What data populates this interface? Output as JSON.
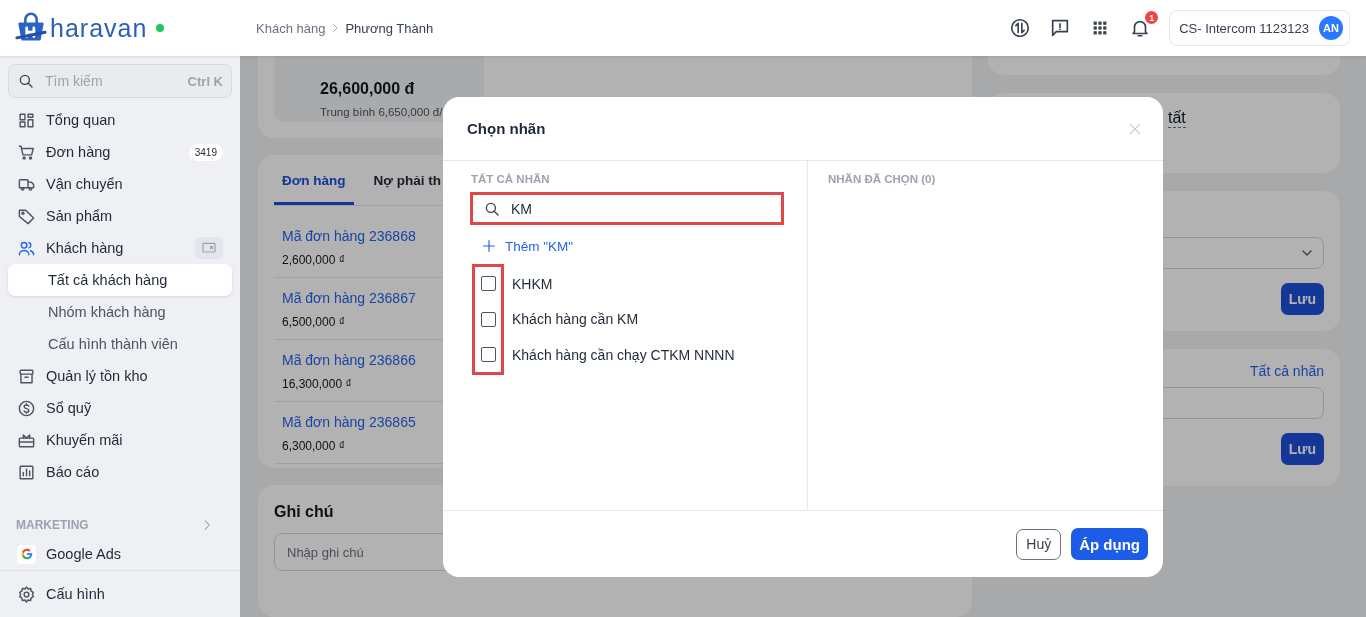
{
  "header": {
    "logo": "haravan",
    "breadcrumb": [
      "Khách hàng",
      "Phương Thành"
    ],
    "notification_count": "1",
    "account": {
      "name": "CS- Intercom 1123123",
      "initials": "AN"
    }
  },
  "sidebar": {
    "search": {
      "placeholder": "Tìm kiếm",
      "shortcut": "Ctrl K"
    },
    "items": [
      {
        "label": "Tổng quan",
        "active": false
      },
      {
        "label": "Đơn hàng",
        "active": false,
        "count": "3419"
      },
      {
        "label": "Vận chuyển",
        "active": false
      },
      {
        "label": "Sản phẩm",
        "active": false
      },
      {
        "label": "Khách hàng",
        "active": true,
        "children": [
          {
            "label": "Tất cả khách hàng",
            "selected": true
          },
          {
            "label": "Nhóm khách hàng",
            "selected": false
          },
          {
            "label": "Cấu hình thành viên",
            "selected": false
          }
        ]
      },
      {
        "label": "Quản lý tồn kho",
        "active": false
      },
      {
        "label": "Sổ quỹ",
        "active": false
      },
      {
        "label": "Khuyến mãi",
        "active": false
      },
      {
        "label": "Báo cáo",
        "active": false
      }
    ],
    "marketing": {
      "title": "MARKETING",
      "items": [
        {
          "label": "Google Ads"
        }
      ]
    },
    "footer_item": {
      "label": "Cấu hình"
    }
  },
  "summary": {
    "total": "26,600,000 đ",
    "average": "Trung bình 6,650,000 đ/"
  },
  "orders_card": {
    "tabs": [
      {
        "label": "Đơn hàng",
        "selected": true
      },
      {
        "label": "Nợ phải th",
        "selected": false
      }
    ],
    "orders": [
      {
        "code": "Mã đơn hàng 236868",
        "amount": "2,600,000 ₫"
      },
      {
        "code": "Mã đơn hàng 236867",
        "amount": "6,500,000 ₫"
      },
      {
        "code": "Mã đơn hàng 236866",
        "amount": "16,300,000 ₫"
      },
      {
        "code": "Mã đơn hàng 236865",
        "amount": "6,300,000 ₫"
      }
    ]
  },
  "note_card": {
    "title": "Ghi chú",
    "placeholder": "Nhập ghi chú"
  },
  "right_column": {
    "partial_text": "tất",
    "save_button": "Lưu",
    "tags_link": "Tất cả nhãn",
    "tags_save_button": "Lưu"
  },
  "modal": {
    "title": "Chọn nhãn",
    "all_heading": "TẤT CẢ NHÃN",
    "search": {
      "value": "KM",
      "highlighted": true
    },
    "add_option": "Thêm \"KM\"",
    "labels": [
      {
        "label": "KHKM",
        "checked": false
      },
      {
        "label": "Khách hàng cần KM",
        "checked": false
      },
      {
        "label": "Khách hàng cần chạy CTKM NNNN",
        "checked": false
      }
    ],
    "checkboxes_highlighted": true,
    "selected_heading": "NHÃN ĐÃ CHỌN (0)",
    "cancel_button": "Huỷ",
    "apply_button": "Áp dụng"
  }
}
